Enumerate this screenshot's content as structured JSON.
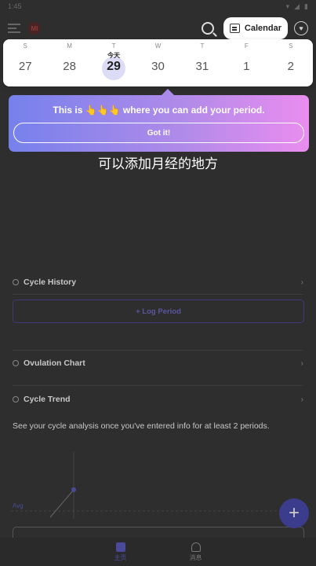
{
  "status": {
    "time": "1:45"
  },
  "appbar": {
    "avatar_text": "MI",
    "calendar_label": "Calendar"
  },
  "week": {
    "days": [
      {
        "letter": "S",
        "num": "27"
      },
      {
        "letter": "M",
        "num": "28"
      },
      {
        "letter": "T",
        "num": "29",
        "today": "今天"
      },
      {
        "letter": "W",
        "num": "30"
      },
      {
        "letter": "T",
        "num": "31"
      },
      {
        "letter": "F",
        "num": "1"
      },
      {
        "letter": "S",
        "num": "2"
      }
    ]
  },
  "tooltip": {
    "text": "This is 👆👆👆 where you can add your period.",
    "button": "Got it!"
  },
  "caption": "可以添加月经的地方",
  "sections": {
    "cycle_history": "Cycle History",
    "log_period": "+ Log Period",
    "ovulation_chart": "Ovulation Chart",
    "cycle_trend": "Cycle Trend",
    "analysis_text": "See your cycle analysis once you've entered info for at least 2 periods.",
    "avg_label": "Avg"
  },
  "fab": "+",
  "nav": {
    "home": "主页",
    "notifications": "消息"
  },
  "colors": {
    "accent": "#7681ec",
    "accent_end": "#ea8df0",
    "dim_bg": "#2e2e2e"
  }
}
